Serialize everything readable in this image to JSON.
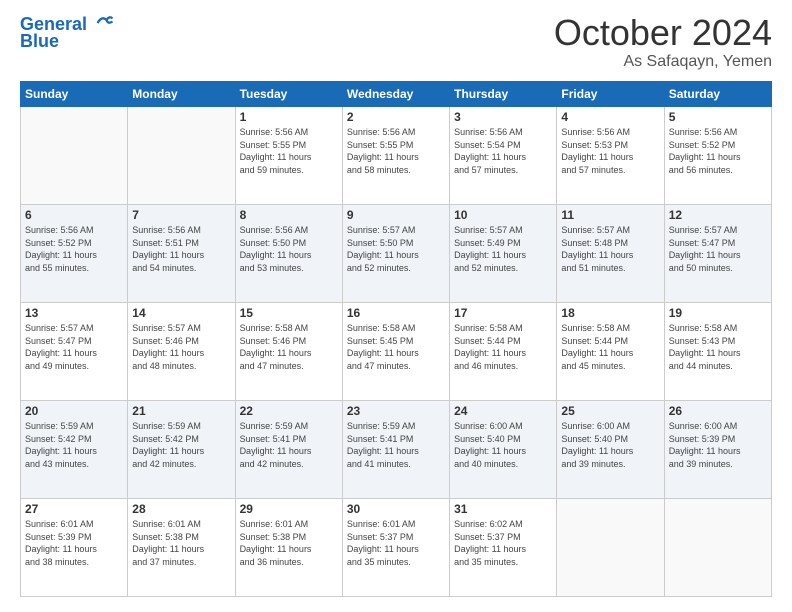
{
  "logo": {
    "line1": "General",
    "line2": "Blue"
  },
  "title": "October 2024",
  "location": "As Safaqayn, Yemen",
  "days_of_week": [
    "Sunday",
    "Monday",
    "Tuesday",
    "Wednesday",
    "Thursday",
    "Friday",
    "Saturday"
  ],
  "weeks": [
    [
      {
        "day": "",
        "info": ""
      },
      {
        "day": "",
        "info": ""
      },
      {
        "day": "1",
        "info": "Sunrise: 5:56 AM\nSunset: 5:55 PM\nDaylight: 11 hours\nand 59 minutes."
      },
      {
        "day": "2",
        "info": "Sunrise: 5:56 AM\nSunset: 5:55 PM\nDaylight: 11 hours\nand 58 minutes."
      },
      {
        "day": "3",
        "info": "Sunrise: 5:56 AM\nSunset: 5:54 PM\nDaylight: 11 hours\nand 57 minutes."
      },
      {
        "day": "4",
        "info": "Sunrise: 5:56 AM\nSunset: 5:53 PM\nDaylight: 11 hours\nand 57 minutes."
      },
      {
        "day": "5",
        "info": "Sunrise: 5:56 AM\nSunset: 5:52 PM\nDaylight: 11 hours\nand 56 minutes."
      }
    ],
    [
      {
        "day": "6",
        "info": "Sunrise: 5:56 AM\nSunset: 5:52 PM\nDaylight: 11 hours\nand 55 minutes."
      },
      {
        "day": "7",
        "info": "Sunrise: 5:56 AM\nSunset: 5:51 PM\nDaylight: 11 hours\nand 54 minutes."
      },
      {
        "day": "8",
        "info": "Sunrise: 5:56 AM\nSunset: 5:50 PM\nDaylight: 11 hours\nand 53 minutes."
      },
      {
        "day": "9",
        "info": "Sunrise: 5:57 AM\nSunset: 5:50 PM\nDaylight: 11 hours\nand 52 minutes."
      },
      {
        "day": "10",
        "info": "Sunrise: 5:57 AM\nSunset: 5:49 PM\nDaylight: 11 hours\nand 52 minutes."
      },
      {
        "day": "11",
        "info": "Sunrise: 5:57 AM\nSunset: 5:48 PM\nDaylight: 11 hours\nand 51 minutes."
      },
      {
        "day": "12",
        "info": "Sunrise: 5:57 AM\nSunset: 5:47 PM\nDaylight: 11 hours\nand 50 minutes."
      }
    ],
    [
      {
        "day": "13",
        "info": "Sunrise: 5:57 AM\nSunset: 5:47 PM\nDaylight: 11 hours\nand 49 minutes."
      },
      {
        "day": "14",
        "info": "Sunrise: 5:57 AM\nSunset: 5:46 PM\nDaylight: 11 hours\nand 48 minutes."
      },
      {
        "day": "15",
        "info": "Sunrise: 5:58 AM\nSunset: 5:46 PM\nDaylight: 11 hours\nand 47 minutes."
      },
      {
        "day": "16",
        "info": "Sunrise: 5:58 AM\nSunset: 5:45 PM\nDaylight: 11 hours\nand 47 minutes."
      },
      {
        "day": "17",
        "info": "Sunrise: 5:58 AM\nSunset: 5:44 PM\nDaylight: 11 hours\nand 46 minutes."
      },
      {
        "day": "18",
        "info": "Sunrise: 5:58 AM\nSunset: 5:44 PM\nDaylight: 11 hours\nand 45 minutes."
      },
      {
        "day": "19",
        "info": "Sunrise: 5:58 AM\nSunset: 5:43 PM\nDaylight: 11 hours\nand 44 minutes."
      }
    ],
    [
      {
        "day": "20",
        "info": "Sunrise: 5:59 AM\nSunset: 5:42 PM\nDaylight: 11 hours\nand 43 minutes."
      },
      {
        "day": "21",
        "info": "Sunrise: 5:59 AM\nSunset: 5:42 PM\nDaylight: 11 hours\nand 42 minutes."
      },
      {
        "day": "22",
        "info": "Sunrise: 5:59 AM\nSunset: 5:41 PM\nDaylight: 11 hours\nand 42 minutes."
      },
      {
        "day": "23",
        "info": "Sunrise: 5:59 AM\nSunset: 5:41 PM\nDaylight: 11 hours\nand 41 minutes."
      },
      {
        "day": "24",
        "info": "Sunrise: 6:00 AM\nSunset: 5:40 PM\nDaylight: 11 hours\nand 40 minutes."
      },
      {
        "day": "25",
        "info": "Sunrise: 6:00 AM\nSunset: 5:40 PM\nDaylight: 11 hours\nand 39 minutes."
      },
      {
        "day": "26",
        "info": "Sunrise: 6:00 AM\nSunset: 5:39 PM\nDaylight: 11 hours\nand 39 minutes."
      }
    ],
    [
      {
        "day": "27",
        "info": "Sunrise: 6:01 AM\nSunset: 5:39 PM\nDaylight: 11 hours\nand 38 minutes."
      },
      {
        "day": "28",
        "info": "Sunrise: 6:01 AM\nSunset: 5:38 PM\nDaylight: 11 hours\nand 37 minutes."
      },
      {
        "day": "29",
        "info": "Sunrise: 6:01 AM\nSunset: 5:38 PM\nDaylight: 11 hours\nand 36 minutes."
      },
      {
        "day": "30",
        "info": "Sunrise: 6:01 AM\nSunset: 5:37 PM\nDaylight: 11 hours\nand 35 minutes."
      },
      {
        "day": "31",
        "info": "Sunrise: 6:02 AM\nSunset: 5:37 PM\nDaylight: 11 hours\nand 35 minutes."
      },
      {
        "day": "",
        "info": ""
      },
      {
        "day": "",
        "info": ""
      }
    ]
  ]
}
